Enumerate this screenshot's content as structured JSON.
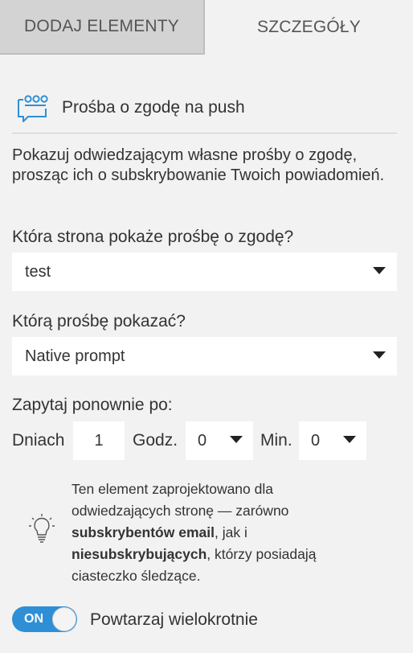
{
  "tabs": {
    "add_elements": "DODAJ ELEMENTY",
    "details": "SZCZEGÓŁY"
  },
  "header": {
    "icon": "speech-bubble-dots-icon",
    "title": "Prośba o zgodę na push"
  },
  "description": "Pokazuj odwiedzającym własne prośby o zgodę, prosząc ich o subskrybowanie Twoich powiadomień.",
  "page_question": {
    "label": "Która strona pokaże prośbę o zgodę?",
    "selected": "test"
  },
  "prompt_question": {
    "label": "Którą prośbę pokazać?",
    "selected": "Native prompt"
  },
  "ask_again": {
    "label": "Zapytaj ponownie po:",
    "days_label": "Dniach",
    "days_value": "1",
    "hours_label": "Godz.",
    "hours_value": "0",
    "minutes_label": "Min.",
    "minutes_value": "0"
  },
  "tip": {
    "icon": "lightbulb-icon",
    "part1": "Ten element zaprojektowano dla odwiedzających stronę — zarówno ",
    "bold1": "subskrybentów email",
    "part2": ", jak i ",
    "bold2": "niesubskrybujących",
    "part3": ", którzy posiadają ciasteczko śledzące."
  },
  "repeat": {
    "toggle_state": "ON",
    "label": "Powtarzaj wielokrotnie"
  },
  "colors": {
    "toggle_on": "#2f8fd6",
    "background": "#f2f2f2",
    "inactive_tab": "#d3d3d3"
  }
}
